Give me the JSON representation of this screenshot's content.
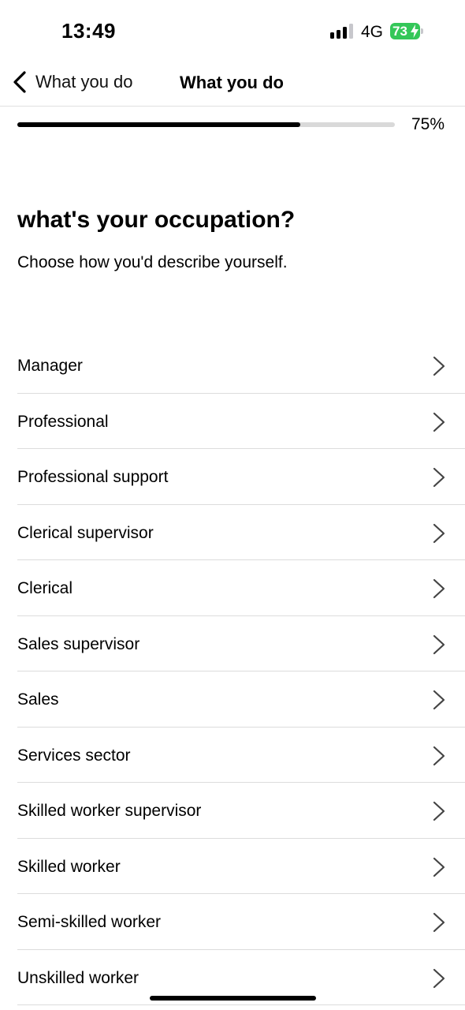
{
  "status_bar": {
    "time": "13:49",
    "network": "4G",
    "battery": "73",
    "battery_color": "#34c759"
  },
  "nav": {
    "back_label": "What you do",
    "title": "What you do"
  },
  "progress": {
    "value": 0.75,
    "label": "75%"
  },
  "content": {
    "title": "what's your occupation?",
    "subtitle": "Choose how you'd describe yourself."
  },
  "occupations": [
    {
      "label": "Manager"
    },
    {
      "label": "Professional"
    },
    {
      "label": "Professional support"
    },
    {
      "label": "Clerical supervisor"
    },
    {
      "label": "Clerical"
    },
    {
      "label": "Sales supervisor"
    },
    {
      "label": "Sales"
    },
    {
      "label": "Services sector"
    },
    {
      "label": "Skilled worker supervisor"
    },
    {
      "label": "Skilled worker"
    },
    {
      "label": "Semi-skilled worker"
    },
    {
      "label": "Unskilled worker"
    }
  ]
}
